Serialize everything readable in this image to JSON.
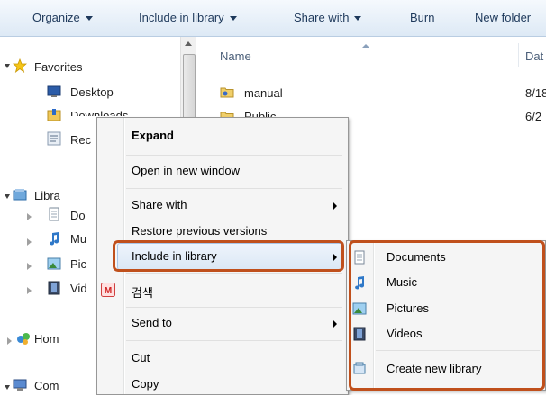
{
  "toolbar": {
    "organize": "Organize",
    "include_in_library": "Include in library",
    "share_with": "Share with",
    "burn": "Burn",
    "new_folder": "New folder"
  },
  "nav": {
    "favorites": "Favorites",
    "desktop": "Desktop",
    "downloads": "Downloads",
    "recent": "Rec",
    "libraries": "Libra",
    "documents": "Do",
    "music": "Mu",
    "pictures": "Pic",
    "videos": "Vid",
    "homegroup": "Hom",
    "computer": "Com"
  },
  "columns": {
    "name": "Name",
    "date": "Dat"
  },
  "files": [
    {
      "name": "manual",
      "date": "8/18"
    },
    {
      "name": "Public",
      "date": "6/2"
    }
  ],
  "context_menu": {
    "expand": "Expand",
    "open_new_window": "Open in new window",
    "share_with": "Share with",
    "restore": "Restore previous versions",
    "include_in_library": "Include in library",
    "search_kr": "검색",
    "send_to": "Send to",
    "cut": "Cut",
    "copy": "Copy"
  },
  "submenu": {
    "documents": "Documents",
    "music": "Music",
    "pictures": "Pictures",
    "videos": "Videos",
    "create_new_library": "Create new library"
  },
  "colors": {
    "highlight": "#c0501c"
  }
}
